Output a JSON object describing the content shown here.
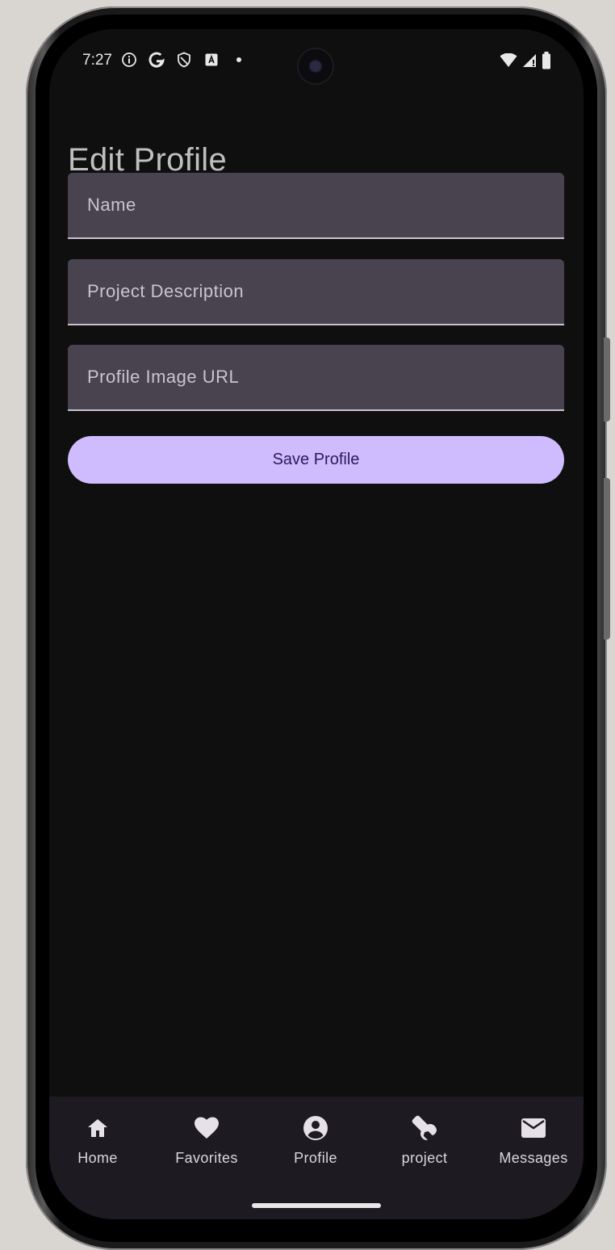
{
  "status_bar": {
    "time": "7:27",
    "icons": [
      "info-icon",
      "google-icon",
      "shield-icon",
      "keyboard-icon",
      "dot-icon"
    ],
    "right_icons": [
      "wifi-icon",
      "signal-icon",
      "battery-icon"
    ]
  },
  "page": {
    "title": "Edit Profile"
  },
  "form": {
    "name_placeholder": "Name",
    "name_value": "",
    "description_placeholder": "Project Description",
    "description_value": "",
    "image_url_placeholder": "Profile Image URL",
    "image_url_value": "",
    "save_label": "Save Profile"
  },
  "nav": {
    "items": [
      {
        "label": "Home",
        "icon": "home-icon"
      },
      {
        "label": "Favorites",
        "icon": "heart-icon"
      },
      {
        "label": "Profile",
        "icon": "account-circle-icon"
      },
      {
        "label": "project",
        "icon": "wrench-icon"
      },
      {
        "label": "Messages",
        "icon": "mail-icon"
      }
    ]
  },
  "colors": {
    "background": "#0f0f0f",
    "field": "#48434f",
    "accent": "#cfbcff",
    "accent_text": "#2b1a58",
    "navbar": "#1d1a22"
  }
}
